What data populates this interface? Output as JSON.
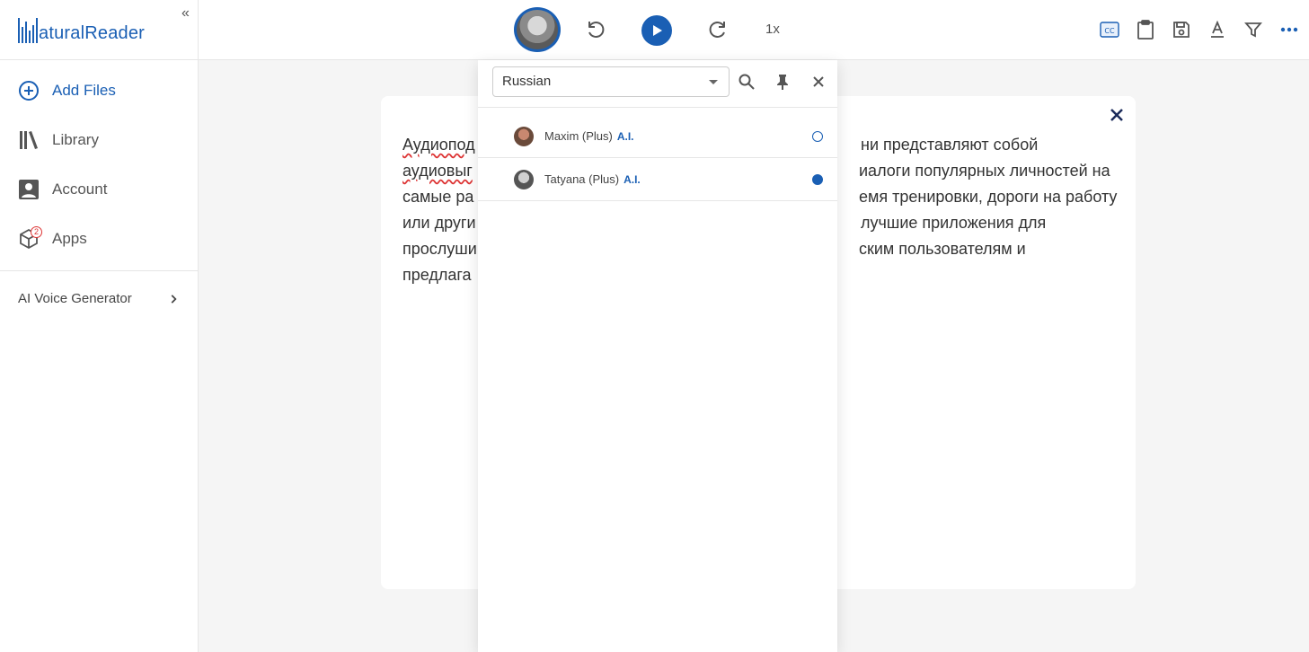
{
  "app": {
    "logo_text": "NaturalReader",
    "logo_rest": "aturalReader"
  },
  "sidebar": {
    "items": [
      {
        "label": "Add Files",
        "icon": "plus-circle-icon",
        "active": true
      },
      {
        "label": "Library",
        "icon": "library-icon",
        "active": false
      },
      {
        "label": "Account",
        "icon": "account-icon",
        "active": false
      },
      {
        "label": "Apps",
        "icon": "apps-cube-icon",
        "active": false,
        "badge": "2"
      }
    ],
    "ai_voice_generator": "AI Voice Generator"
  },
  "toolbar": {
    "speed": "1x",
    "accent_color": "#1a5fb4"
  },
  "document": {
    "lines": [
      {
        "left": "Аудиопод",
        "right": "ни представляют собой"
      },
      {
        "left": "аудиовыг",
        "right": "иалоги популярных личностей на"
      },
      {
        "left": "самые ра",
        "right": "емя тренировки, дороги на работу"
      },
      {
        "left": "или други",
        "right": "лучшие приложения для"
      },
      {
        "left": "прослуши",
        "right": "ским пользователям и"
      },
      {
        "left": "предлага",
        "right": ""
      }
    ]
  },
  "voice_panel": {
    "language": "Russian",
    "voices": [
      {
        "name": "Maxim (Plus)",
        "tag": "A.I.",
        "selected": false
      },
      {
        "name": "Tatyana (Plus)",
        "tag": "A.I.",
        "selected": true
      }
    ]
  }
}
